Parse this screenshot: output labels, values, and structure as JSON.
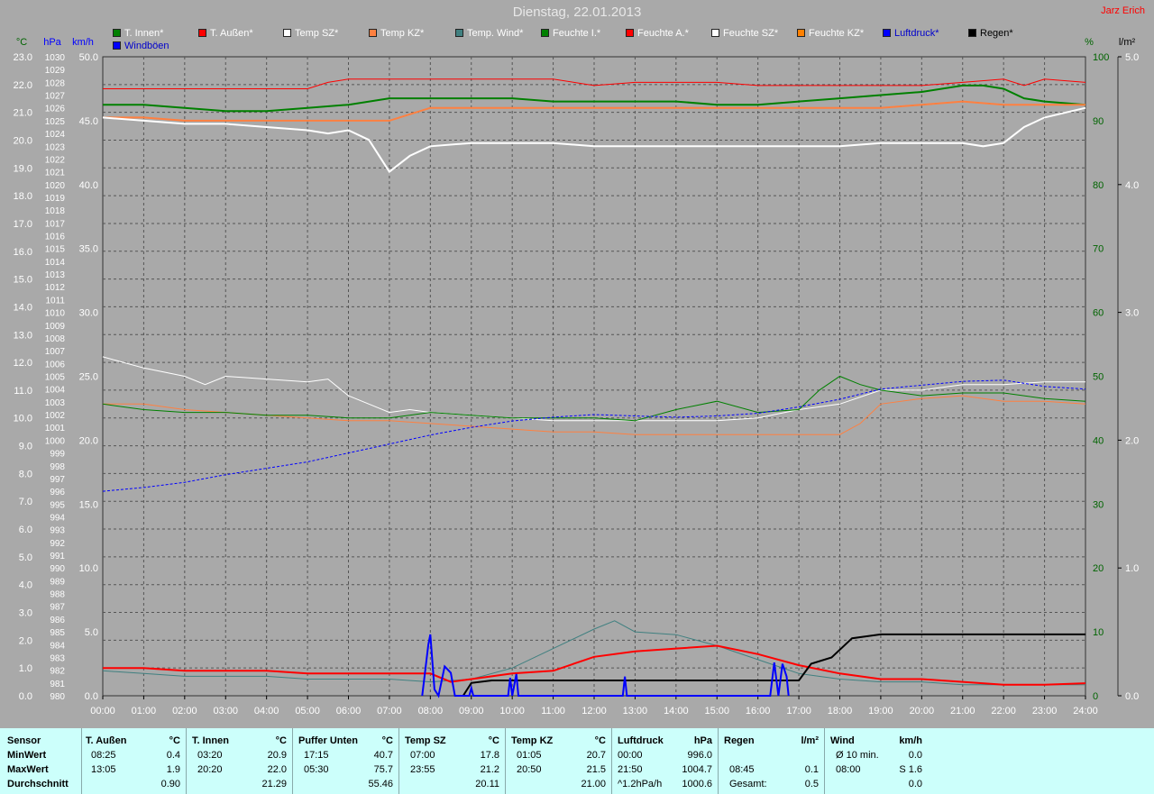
{
  "title": "Dienstag, 22.01.2013",
  "author": "Jarz Erich",
  "units": {
    "temp": "°C",
    "pressure": "hPa",
    "wind": "km/h",
    "humidity": "%",
    "rain": "l/m²"
  },
  "legend": [
    {
      "label": "T. Innen*",
      "color": "#008000"
    },
    {
      "label": "T. Außen*",
      "color": "#ff0000"
    },
    {
      "label": "Temp SZ*",
      "color": "#ffffff"
    },
    {
      "label": "Temp KZ*",
      "color": "#ff8040"
    },
    {
      "label": "Temp. Wind*",
      "color": "#408080"
    },
    {
      "label": "Feuchte I.*",
      "color": "#008000"
    },
    {
      "label": "Feuchte A.*",
      "color": "#ff0000"
    },
    {
      "label": "Feuchte SZ*",
      "color": "#ffffff"
    },
    {
      "label": "Feuchte KZ*",
      "color": "#ff8000"
    },
    {
      "label": "Luftdruck*",
      "color": "#0000ff"
    },
    {
      "label": "Regen*",
      "color": "#000000"
    },
    {
      "label": "Windböen",
      "color": "#0000ff"
    }
  ],
  "chart_data": {
    "type": "line",
    "x_labels": [
      "00:00",
      "01:00",
      "02:00",
      "03:00",
      "04:00",
      "05:00",
      "06:00",
      "07:00",
      "08:00",
      "09:00",
      "10:00",
      "11:00",
      "12:00",
      "13:00",
      "14:00",
      "15:00",
      "16:00",
      "17:00",
      "18:00",
      "19:00",
      "20:00",
      "21:00",
      "22:00",
      "23:00",
      "24:00"
    ],
    "axes": {
      "temp": {
        "ylim": [
          0,
          23
        ],
        "ticks": [
          "0.0",
          "1.0",
          "2.0",
          "3.0",
          "4.0",
          "5.0",
          "6.0",
          "7.0",
          "8.0",
          "9.0",
          "10.0",
          "11.0",
          "12.0",
          "13.0",
          "14.0",
          "15.0",
          "16.0",
          "17.0",
          "18.0",
          "19.0",
          "20.0",
          "21.0",
          "22.0",
          "23.0"
        ]
      },
      "pressure": {
        "ylim": [
          980,
          1030
        ]
      },
      "wind": {
        "ylim": [
          0,
          50
        ],
        "ticks": [
          "0.0",
          "5.0",
          "10.0",
          "15.0",
          "20.0",
          "25.0",
          "30.0",
          "35.0",
          "40.0",
          "45.0",
          "50.0"
        ]
      },
      "humidity": {
        "ylim": [
          0,
          100
        ],
        "ticks": [
          "0",
          "10",
          "20",
          "30",
          "40",
          "50",
          "60",
          "70",
          "80",
          "90",
          "100"
        ]
      },
      "rain": {
        "ylim": [
          0,
          5
        ],
        "ticks": [
          "0.0",
          "1.0",
          "2.0",
          "3.0",
          "4.0",
          "5.0"
        ]
      }
    },
    "grid": true,
    "series": [
      {
        "name": "Feuchte A.*",
        "axis": "humidity",
        "color": "#ff0000",
        "width": 1,
        "x": [
          0,
          5,
          5.5,
          6,
          7,
          8,
          9,
          10,
          11,
          12,
          13,
          14,
          15,
          16,
          17,
          18,
          19,
          20,
          21,
          22,
          22.5,
          23,
          24
        ],
        "y": [
          95,
          95,
          96,
          96.5,
          96.5,
          96.5,
          96.5,
          96.5,
          96.5,
          95.5,
          96,
          96,
          96,
          95.5,
          95.5,
          95.5,
          95.5,
          95.5,
          96,
          96.5,
          95.5,
          96.5,
          96
        ]
      },
      {
        "name": "Feuchte I.*",
        "axis": "humidity",
        "color": "#008000",
        "width": 2,
        "x": [
          0,
          1,
          2,
          3,
          4,
          5,
          6,
          7,
          8,
          9,
          10,
          11,
          12,
          13,
          14,
          15,
          16,
          17,
          18,
          19,
          20,
          21,
          21.5,
          22,
          22.5,
          23,
          24
        ],
        "y": [
          92.5,
          92.5,
          92,
          91.5,
          91.5,
          92,
          92.5,
          93.5,
          93.5,
          93.5,
          93.5,
          93,
          93,
          93,
          93,
          92.5,
          92.5,
          93,
          93.5,
          94,
          94.5,
          95.5,
          95.5,
          95,
          93.5,
          93,
          92.5
        ]
      },
      {
        "name": "Feuchte KZ*",
        "axis": "humidity",
        "color": "#ff8040",
        "width": 2,
        "x": [
          0,
          1,
          2,
          3,
          4,
          5,
          6,
          7,
          8,
          9,
          10,
          11,
          12,
          13,
          14,
          15,
          16,
          17,
          18,
          19,
          20,
          21,
          22,
          23,
          24
        ],
        "y": [
          90.5,
          90.5,
          90,
          90,
          90,
          90,
          90,
          90,
          92,
          92,
          92,
          92,
          92,
          92,
          92,
          92,
          92,
          92,
          92,
          92,
          92.5,
          93,
          92.5,
          92.5,
          92.5
        ]
      },
      {
        "name": "Feuchte SZ*",
        "axis": "humidity",
        "color": "#ffffff",
        "width": 2,
        "x": [
          0,
          1,
          2,
          3,
          4,
          5,
          5.5,
          6,
          6.5,
          7,
          7.5,
          8,
          9,
          10,
          11,
          12,
          13,
          14,
          15,
          16,
          17,
          18,
          19,
          20,
          21,
          21.5,
          22,
          22.5,
          23,
          24
        ],
        "y": [
          90.5,
          90,
          89.5,
          89.5,
          89,
          88.5,
          88,
          88.5,
          87,
          82,
          84.5,
          86,
          86.5,
          86.5,
          86.5,
          86,
          86,
          86,
          86,
          86,
          86,
          86,
          86.5,
          86.5,
          86.5,
          86,
          86.5,
          89,
          90.5,
          92
        ]
      },
      {
        "name": "Temp SZ*",
        "axis": "temp",
        "color": "#ffffff",
        "width": 1,
        "x": [
          0,
          1,
          2,
          2.5,
          3,
          4,
          5,
          5.5,
          6,
          6.5,
          7,
          7.5,
          8,
          9,
          10,
          11,
          12,
          13,
          14,
          15,
          16,
          17,
          18,
          19,
          20,
          21,
          22,
          23,
          24
        ],
        "y": [
          12.2,
          11.8,
          11.5,
          11.2,
          11.5,
          11.4,
          11.3,
          11.4,
          10.8,
          10.5,
          10.2,
          10.3,
          10.2,
          10.1,
          10.0,
          9.9,
          9.9,
          9.9,
          9.9,
          9.9,
          10.0,
          10.3,
          10.5,
          11,
          11,
          11.2,
          11.2,
          11.3,
          11.3
        ]
      },
      {
        "name": "Temp KZ*",
        "axis": "temp",
        "color": "#ff8040",
        "width": 1,
        "x": [
          0,
          1,
          2,
          3,
          4,
          5,
          6,
          7,
          8,
          9,
          10,
          11,
          12,
          13,
          14,
          15,
          16,
          17,
          18,
          18.5,
          19,
          20,
          21,
          22,
          23,
          24
        ],
        "y": [
          10.5,
          10.5,
          10.3,
          10.2,
          10.1,
          10.0,
          9.9,
          9.9,
          9.8,
          9.7,
          9.6,
          9.5,
          9.5,
          9.4,
          9.4,
          9.4,
          9.4,
          9.4,
          9.4,
          9.8,
          10.5,
          10.7,
          10.8,
          10.6,
          10.6,
          10.5
        ]
      },
      {
        "name": "T. Innen*",
        "axis": "temp",
        "color": "#008000",
        "width": 1,
        "x": [
          0,
          1,
          2,
          3,
          4,
          5,
          6,
          7,
          8,
          9,
          10,
          11,
          12,
          13,
          14,
          15,
          16,
          17,
          17.5,
          18,
          18.5,
          19,
          20,
          21,
          22,
          23,
          24
        ],
        "y": [
          10.5,
          10.3,
          10.2,
          10.2,
          10.1,
          10.1,
          10.0,
          10.0,
          10.2,
          10.1,
          10.0,
          10.0,
          10.0,
          9.9,
          10.3,
          10.6,
          10.2,
          10.3,
          11.0,
          11.5,
          11.2,
          11,
          10.8,
          10.9,
          10.9,
          10.7,
          10.6
        ]
      },
      {
        "name": "Luftdruck*",
        "axis": "pressure",
        "color": "#0000ff",
        "width": 1,
        "dashed": true,
        "x": [
          0,
          1,
          2,
          3,
          4,
          5,
          6,
          7,
          8,
          9,
          10,
          11,
          12,
          13,
          14,
          15,
          16,
          17,
          18,
          19,
          20,
          21,
          22,
          23,
          24
        ],
        "y": [
          996,
          996.3,
          996.7,
          997.3,
          997.8,
          998.3,
          999.0,
          999.7,
          1000.4,
          1001.0,
          1001.5,
          1001.8,
          1002.0,
          1001.9,
          1001.8,
          1001.9,
          1002.1,
          1002.6,
          1003.2,
          1004.0,
          1004.3,
          1004.6,
          1004.7,
          1004.2,
          1004.0
        ]
      },
      {
        "name": "Temp. Wind*",
        "axis": "temp",
        "color": "#408080",
        "width": 1,
        "x": [
          0,
          1,
          2,
          3,
          4,
          5,
          6,
          7,
          8,
          9,
          10,
          11,
          12,
          12.5,
          13,
          14,
          15,
          16,
          17,
          18,
          19,
          20,
          21,
          22,
          23,
          24
        ],
        "y": [
          0.9,
          0.8,
          0.7,
          0.7,
          0.7,
          0.6,
          0.6,
          0.6,
          0.5,
          0.6,
          1.0,
          1.7,
          2.4,
          2.7,
          2.3,
          2.2,
          1.8,
          1.3,
          0.8,
          0.6,
          0.5,
          0.5,
          0.4,
          0.4,
          0.4,
          0.4
        ]
      },
      {
        "name": "T. Außen*",
        "axis": "temp",
        "color": "#ff0000",
        "width": 2,
        "x": [
          0,
          1,
          2,
          3,
          4,
          5,
          6,
          7,
          8,
          8.5,
          9,
          10,
          11,
          12,
          13,
          14,
          15,
          16,
          17,
          18,
          19,
          20,
          21,
          22,
          23,
          24
        ],
        "y": [
          1.0,
          1.0,
          0.9,
          0.9,
          0.9,
          0.8,
          0.8,
          0.8,
          0.8,
          0.5,
          0.6,
          0.8,
          0.9,
          1.4,
          1.6,
          1.7,
          1.8,
          1.5,
          1.1,
          0.8,
          0.6,
          0.6,
          0.5,
          0.4,
          0.4,
          0.45
        ]
      },
      {
        "name": "Regen*",
        "axis": "rain",
        "color": "#000000",
        "width": 2,
        "x": [
          8.8,
          9,
          9.5,
          10,
          11,
          12,
          13,
          14,
          15,
          16,
          17,
          17.3,
          17.8,
          18.3,
          19,
          20,
          21,
          22,
          23,
          24
        ],
        "y": [
          0,
          0.1,
          0.12,
          0.12,
          0.12,
          0.12,
          0.12,
          0.12,
          0.12,
          0.12,
          0.12,
          0.25,
          0.3,
          0.45,
          0.48,
          0.48,
          0.48,
          0.48,
          0.48,
          0.48
        ]
      },
      {
        "name": "Windböen",
        "axis": "wind",
        "color": "#0000ff",
        "width": 2,
        "x": [
          7.8,
          7.95,
          8.0,
          8.1,
          8.2,
          8.35,
          8.5,
          8.6,
          8.7,
          8.95,
          9.0,
          9.05,
          9.9,
          9.95,
          10.0,
          10.1,
          10.15,
          10.2,
          12.7,
          12.75,
          12.8,
          16.3,
          16.4,
          16.5,
          16.6,
          16.7,
          16.75
        ],
        "y": [
          0,
          4.0,
          4.8,
          0.5,
          0,
          2.3,
          1.8,
          0,
          0,
          0,
          0.6,
          0,
          0,
          1.4,
          0,
          1.7,
          0,
          0,
          0,
          1.5,
          0,
          0,
          2.6,
          0,
          2.5,
          1.5,
          0
        ]
      }
    ]
  },
  "stats": {
    "headers": [
      "Sensor",
      "T. Außen",
      "°C",
      "T. Innen",
      "°C",
      "Puffer Unten",
      "°C",
      "Temp SZ",
      "°C",
      "Temp KZ",
      "°C",
      "Luftdruck",
      "hPa",
      "Regen",
      "l/m²",
      "Wind",
      "km/h"
    ],
    "rows": [
      {
        "label": "MinWert",
        "cols": [
          "08:25",
          "0.4",
          "03:20",
          "20.9",
          "17:15",
          "40.7",
          "07:00",
          "17.8",
          "01:05",
          "20.7",
          "00:00",
          "996.0",
          "",
          "",
          "Ø 10 min.",
          "0.0"
        ]
      },
      {
        "label": "MaxWert",
        "cols": [
          "13:05",
          "1.9",
          "20:20",
          "22.0",
          "05:30",
          "75.7",
          "23:55",
          "21.2",
          "20:50",
          "21.5",
          "21:50",
          "1004.7",
          "08:45",
          "0.1",
          "08:00",
          "S 1.6"
        ]
      },
      {
        "label": "Durchschnitt",
        "cols": [
          "",
          "0.90",
          "",
          "21.29",
          "",
          "55.46",
          "",
          "20.11",
          "",
          "21.00",
          "^1.2hPa/h",
          "1000.6",
          "Gesamt:",
          "0.5",
          "",
          "0.0"
        ]
      }
    ]
  }
}
